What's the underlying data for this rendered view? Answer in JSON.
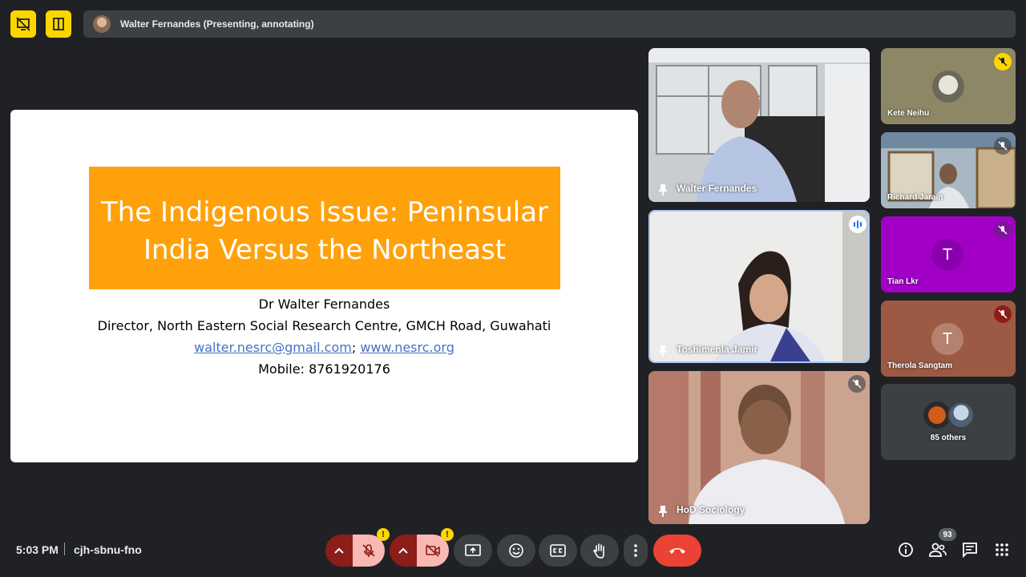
{
  "top_bar": {
    "presenter_label": "Walter Fernandes (Presenting, annotating)"
  },
  "slide": {
    "title_line1": "The Indigenous Issue: Peninsular",
    "title_line2": "India Versus the Northeast",
    "author": "Dr Walter Fernandes",
    "affiliation": "Director, North Eastern Social Research Centre, GMCH Road, Guwahati",
    "email": "walter.nesrc@gmail.com",
    "separator": ";",
    "website": "www.nesrc.org",
    "mobile": "Mobile: 8761920176",
    "colors": {
      "title_bg": "#ffa10a",
      "link": "#4472c4"
    }
  },
  "participants": {
    "main": [
      {
        "name": "Walter Fernandes"
      },
      {
        "name": "Toshimenla Jamir"
      },
      {
        "name": "HoD Sociology"
      }
    ],
    "side": [
      {
        "name": "Kete Neihu"
      },
      {
        "name": "Richard Jarain"
      },
      {
        "name": "Tian Lkr",
        "initial": "T",
        "avatar_color": "#a200c7"
      },
      {
        "name": "Therola Sangtam",
        "initial": "T",
        "avatar_color": "#9c5a45"
      }
    ],
    "others_label": "85 others"
  },
  "bottom_bar": {
    "time": "5:03 PM",
    "meeting_code": "cjh-sbnu-fno",
    "warning_badge": "!",
    "participant_count": "93"
  },
  "icons": [
    "present-mode-icon",
    "layout-icon",
    "pin-icon",
    "mic-off-icon",
    "speaking-icon",
    "chevron-up-icon",
    "camera-off-icon",
    "present-screen-icon",
    "emoji-icon",
    "captions-icon",
    "raise-hand-icon",
    "more-options-icon",
    "end-call-icon",
    "info-icon",
    "people-icon",
    "chat-icon",
    "activities-icon"
  ]
}
